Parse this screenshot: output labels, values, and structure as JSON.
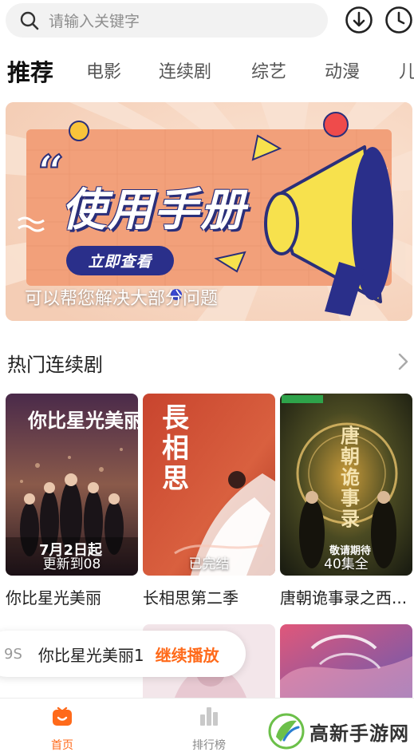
{
  "search": {
    "placeholder": "请输入关键字"
  },
  "tabs": [
    {
      "label": "推荐",
      "active": true
    },
    {
      "label": "电影"
    },
    {
      "label": "连续剧"
    },
    {
      "label": "综艺"
    },
    {
      "label": "动漫"
    },
    {
      "label": "儿"
    }
  ],
  "banner": {
    "title": "使用手册",
    "button_label": "立即查看",
    "caption": "可以帮您解决大部分问题"
  },
  "section": {
    "title": "热门连续剧"
  },
  "cards": [
    {
      "title": "你比星光美丽",
      "poster_title": "你比星光美丽",
      "poster_date": "7月2日起",
      "badge": "更新到08"
    },
    {
      "title": "长相思第二季",
      "poster_title": "長相思",
      "badge": "已完结"
    },
    {
      "title": "唐朝诡事录之西...",
      "poster_title": "唐朝诡事录",
      "poster_note": "敬请期待",
      "badge": "40集全"
    }
  ],
  "continue": {
    "episode": "9S",
    "name": "你比星光美丽1",
    "action": "继续播放"
  },
  "bottom_nav": [
    {
      "label": "首页",
      "active": true,
      "icon": "home-icon"
    },
    {
      "label": "排行榜",
      "icon": "ranking-icon"
    }
  ],
  "watermark": {
    "text": "高新手游网"
  },
  "colors": {
    "accent": "#ff6a1a",
    "banner_navy": "#2a2f8a",
    "banner_peach": "#f5a57f"
  }
}
